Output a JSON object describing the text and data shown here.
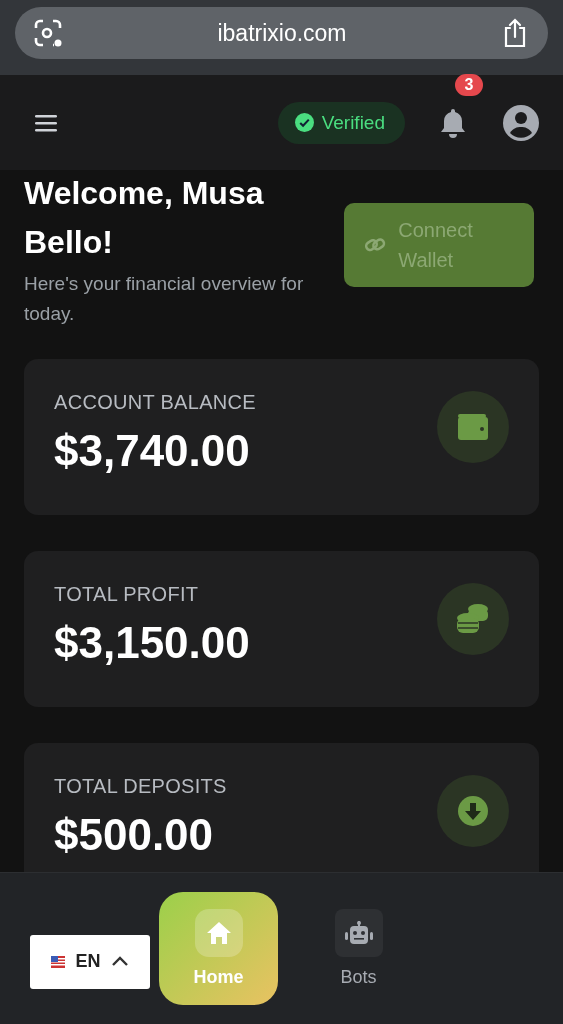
{
  "browser": {
    "url": "ibatrixio.com"
  },
  "header": {
    "badge": "Verified",
    "verified": true,
    "notifications": "3"
  },
  "welcome": {
    "title": "Welcome, Musa Bello!",
    "subtitle": "Here's your financial overview for today.",
    "button": "Connect Wallet"
  },
  "cards": [
    {
      "label": "ACCOUNT BALANCE",
      "value": "$3,740.00",
      "kind": "wallet"
    },
    {
      "label": "TOTAL PROFIT",
      "value": "$3,150.00",
      "kind": "coins"
    },
    {
      "label": "TOTAL DEPOSITS",
      "value": "$500.00",
      "kind": "deposit"
    }
  ],
  "language": {
    "code": "EN"
  },
  "nav": [
    {
      "label": "Home",
      "kind": "home",
      "selected": true
    },
    {
      "label": "Bots",
      "kind": "robot",
      "selected": false
    }
  ]
}
